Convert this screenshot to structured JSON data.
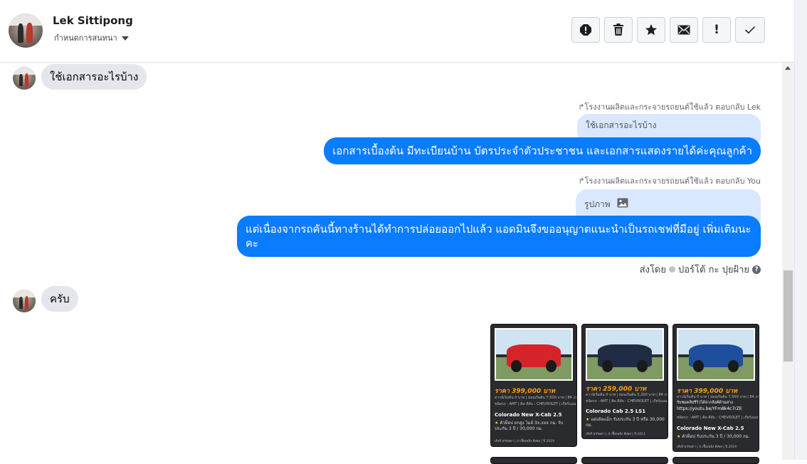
{
  "header": {
    "user_name": "Lek Sittipong",
    "status_label": "กำหนดการสนทนา",
    "toolbar": [
      {
        "name": "report-icon",
        "label": ""
      },
      {
        "name": "trash-icon",
        "label": ""
      },
      {
        "name": "star-icon",
        "label": ""
      },
      {
        "name": "mail-icon",
        "label": ""
      },
      {
        "name": "exclamation-icon",
        "label": "!"
      },
      {
        "name": "check-icon",
        "label": ""
      }
    ]
  },
  "messages": {
    "incoming_1": "ใช้เอกสารอะไรบ้าง",
    "reply_note_1": "↱โรงงานผลิตและกระจายรถยนต์ใช้แล้ว ตอบกลับ Lek",
    "reply_quote_1": "ใช้เอกสารอะไรบ้าง",
    "outgoing_1": "เอกสารเบื้องต้น มีทะเบียนบ้าน บัตรประจำตัวประชาชน และเอกสารแสดงรายได้ค่ะคุณลูกค้า",
    "reply_note_2": "↱โรงงานผลิตและกระจายรถยนต์ใช้แล้ว ตอบกลับ You",
    "reply_quote_2": "รูปภาพ",
    "outgoing_2": "แต่เนื่องจากรถคันนี้ทางร้านได้ทำการปล่อยออกไปแล้ว แอดมินจึงขออนุญาตแนะนำเป็นรถเชฟที่มีอยู่ เพิ่มเติมนะคะ",
    "sent_by_prefix": "ส่งโดย",
    "sent_by_name": "ปอร์โต้ กะ ปุยฝ้าย",
    "incoming_2": "ครับ"
  },
  "cards": [
    {
      "price": "ราคา 399,000 บาท",
      "tiny_1": "ดาวน์เริ่มต้น 0 บาท | ผ่อนเริ่มต้น 7,500 บาท | 84 งวด",
      "tiny_2": "ชนิดรถ : AMT | ติด ตีดับ : CHEVROLET | เกียร์แมน",
      "model": "Colorado New X-Cab 2.5",
      "desc": "ตัวท็อป ยกสูง ไมล์ 3x,xxx กม. รับประกัน 3 ปี / 30,000 กม.",
      "foot": "เกียร์ ธรรมดา | 4 เชื้อเพลิง ดีเซล | ปี 2019",
      "car_color": "#d6232a"
    },
    {
      "price": "ราคา 259,000 บาท",
      "tiny_1": "ดาวน์เริ่มต้น 0 บาท | ผ่อนเริ่มต้น 5,200 บาท | 84 งวด",
      "tiny_2": "ชนิดรถ : AMT | ติด ตีดับ : CHEVROLET | เกียร์แมน",
      "model": "Colorado Cab 2.5 LS1",
      "desc": "แต่งล้อแม็ก รับประกัน 3 ปี หรือ 30,000 กม.",
      "foot": "เกียร์ ธรรมดา | 4 เชื้อเพลิง ดีเซล | ปี 2011",
      "car_color": "#1f2c44"
    },
    {
      "price": "ราคา 399,000 บาท",
      "tiny_1": "ดาวน์เริ่มต้น 0 บาท | ผ่อนเริ่มต้น 7,500 บาท | 84 งวด",
      "note": "รับชมคลิปรีวิวได้จากลิงค์ด้านล่าง",
      "link": "https://youtu.be/YFm8k4c7rZE",
      "tiny_2": "ชนิดรถ : AMT | ติด ตีดับ : CHEVROLET | เกียร์แมน",
      "model": "Colorado New X-Cab 2.5",
      "desc": "ตัวท็อป รับประกัน 3 ปี / 30,000 กม.",
      "foot": "เกียร์ ธรรมดา | 4 เชื้อเพลิง ดีเซล | ปี 2019",
      "car_color": "#1e4f9c"
    }
  ],
  "colors": {
    "outgoing_bubble": "#0a7cff",
    "incoming_bubble": "#e4e6eb",
    "reply_quote": "#d9e8ff",
    "price_orange": "#ff9f1a"
  }
}
